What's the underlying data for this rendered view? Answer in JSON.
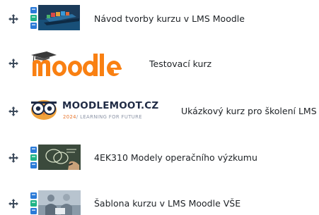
{
  "courses": [
    {
      "name": "Návod tvorby kurzu v LMS Moodle",
      "thumbnail": "ship-on-ocean-with-moodle-icons"
    },
    {
      "name": "Testovací kurz",
      "thumbnail": "moodle-logo"
    },
    {
      "name": "Ukázkový kurz pro školení LMS",
      "thumbnail": "moodlemoot-logo",
      "thumbnail_text": {
        "title": "MOODLEMOOT.CZ",
        "year": "2024",
        "tagline": "/ LEARNING FOR FUTURE"
      }
    },
    {
      "name": "4EK310 Modely operačního výzkumu",
      "thumbnail": "diagram-on-chalkboard-with-moodle-icons"
    },
    {
      "name": "Šablona kurzu v LMS Moodle VŠE",
      "thumbnail": "people-at-desk-with-moodle-icons"
    }
  ],
  "icons": {
    "move": "move-arrows-icon"
  },
  "colors": {
    "moodle_orange": "#f98012",
    "handle": "#3d4b5c",
    "text": "#1d2125"
  }
}
